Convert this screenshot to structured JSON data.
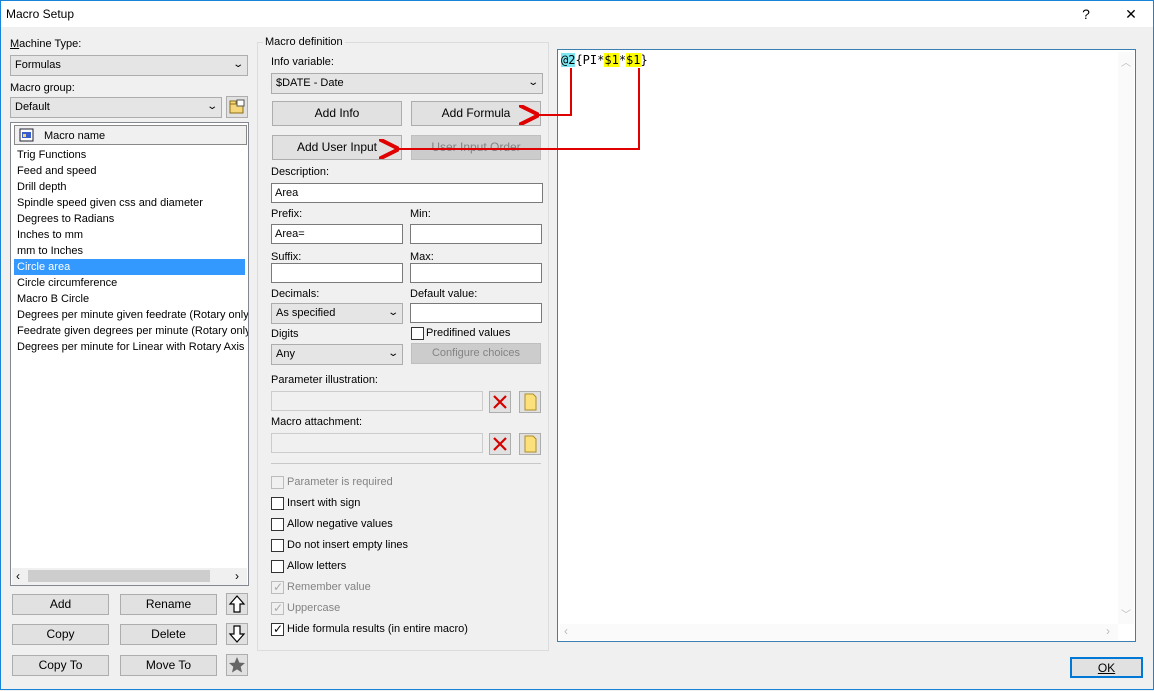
{
  "window": {
    "title": "Macro Setup",
    "help": "?",
    "close": "✕"
  },
  "left": {
    "machine_type_label": "Machine Type:",
    "machine_type_value": "Formulas",
    "macro_group_label": "Macro group:",
    "macro_group_value": "Default",
    "list_header": "Macro name",
    "macros": [
      "Trig Functions",
      "Feed and speed",
      "Drill depth",
      "Spindle speed given css and diameter",
      "Degrees to Radians",
      "Inches to mm",
      "mm to Inches",
      "Circle area",
      "Circle circumference",
      "Macro B Circle",
      "Degrees per minute given feedrate (Rotary only)",
      "Feedrate given degrees per minute (Rotary only)",
      "Degrees per minute for Linear with Rotary Axis m"
    ],
    "selected_index": 7,
    "buttons": {
      "add": "Add",
      "rename": "Rename",
      "copy": "Copy",
      "delete": "Delete",
      "copy_to": "Copy To",
      "move_to": "Move To"
    }
  },
  "definition": {
    "group_label": "Macro definition",
    "info_variable_label": "Info variable:",
    "info_variable_value": "$DATE - Date",
    "add_info": "Add Info",
    "add_formula": "Add Formula",
    "add_user_input": "Add User Input",
    "user_input_order": "User Input Order",
    "description_label": "Description:",
    "description_value": "Area",
    "prefix_label": "Prefix:",
    "prefix_value": "Area=",
    "min_label": "Min:",
    "min_value": "",
    "suffix_label": "Suffix:",
    "suffix_value": "",
    "max_label": "Max:",
    "max_value": "",
    "decimals_label": "Decimals:",
    "decimals_value": "As specified",
    "default_value_label": "Default value:",
    "default_value": "",
    "predefined_values": "Predifined values",
    "digits_label": "Digits",
    "digits_value": "Any",
    "configure_choices": "Configure choices",
    "param_illustration_label": "Parameter illustration:",
    "macro_attachment_label": "Macro attachment:",
    "options": {
      "param_required": "Parameter is required",
      "insert_with_sign": "Insert with sign",
      "allow_negative": "Allow negative values",
      "no_empty_lines": "Do not insert empty lines",
      "allow_letters": "Allow letters",
      "remember_value": "Remember value",
      "uppercase": "Uppercase",
      "hide_formula_results": "Hide formula results (in entire macro)"
    }
  },
  "editor": {
    "tokens": [
      "@2",
      "{PI*",
      "$1",
      "*",
      "$1",
      "}"
    ]
  },
  "ok_button": "OK",
  "colors": {
    "selection": "#3399ff",
    "annotation_arrow": "#e00000",
    "highlight_yellow": "#ffff00",
    "highlight_cyan": "#7fe6f2"
  }
}
